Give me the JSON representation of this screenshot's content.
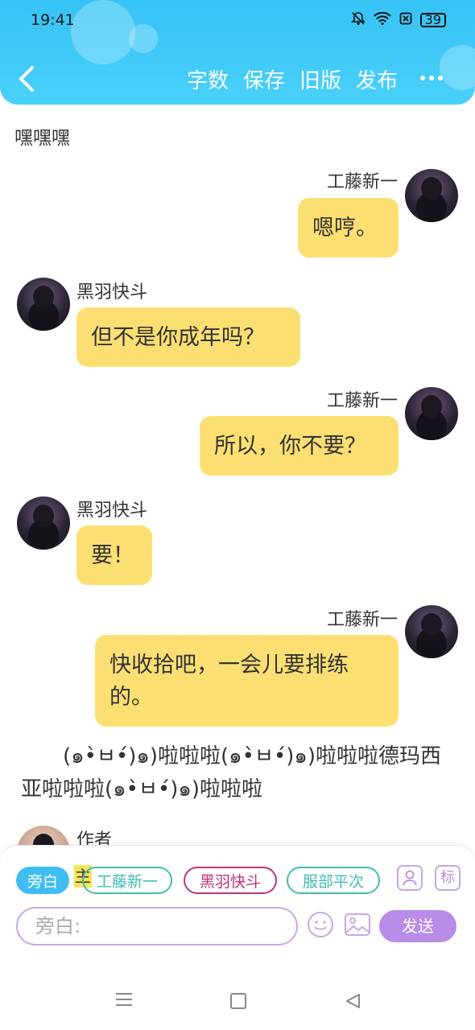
{
  "status_bar": {
    "time": "19:41",
    "battery": "39"
  },
  "header": {
    "actions": [
      "字数",
      "保存",
      "旧版",
      "发布"
    ]
  },
  "narration_top": "嘿嘿嘿",
  "messages": [
    {
      "name": "工藤新一",
      "text": "嗯哼。",
      "side": "right"
    },
    {
      "name": "黑羽快斗",
      "text": "但不是你成年吗？",
      "side": "left"
    },
    {
      "name": "工藤新一",
      "text": "所以，你不要？",
      "side": "right"
    },
    {
      "name": "黑羽快斗",
      "text": "要！",
      "side": "left"
    },
    {
      "name": "工藤新一",
      "text": "快收拾吧，一会儿要排练的。",
      "side": "right"
    }
  ],
  "narration_mid": "(๑•̀ㅂ•́)๑)啦啦啦(๑•̀ㅂ•́)๑)啦啦啦德玛西亚啦啦啦(๑•̀ㅂ•́)๑)啦啦啦",
  "author_label": "作者",
  "composer": {
    "chip_aside": "旁白",
    "main_mark": "主",
    "chip_kudo": "工藤新一",
    "chip_kaito": "黑羽快斗",
    "chip_heiji": "服部平次",
    "tag_label": "标",
    "input_placeholder": "旁白:",
    "send_label": "发送"
  },
  "colors": {
    "header": "#3ec8f7",
    "bubble": "#fcdf72",
    "send": "#b98ce8"
  }
}
